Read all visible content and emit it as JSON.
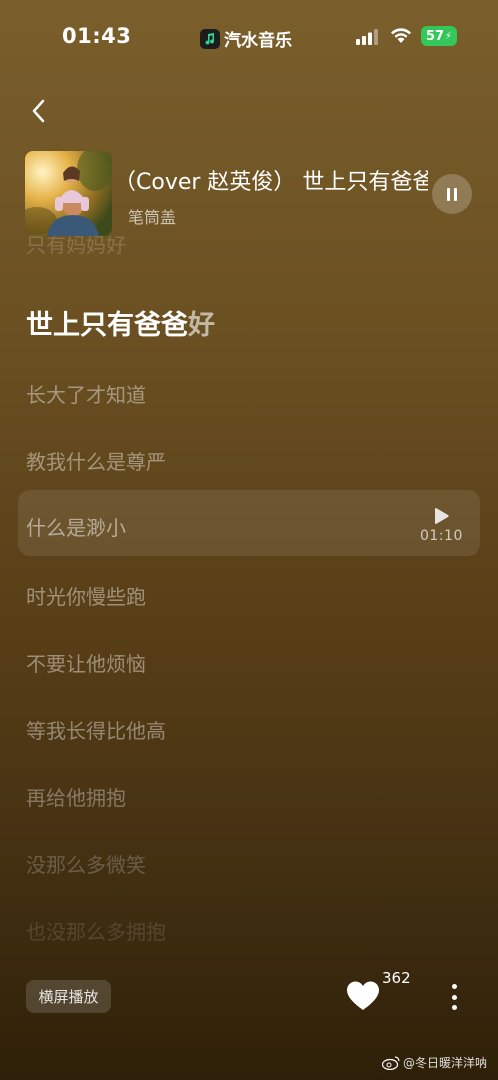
{
  "status_bar": {
    "time": "01:43",
    "app_name": "汽水音乐",
    "battery": "57"
  },
  "now_playing": {
    "title": "（Cover 赵英俊） 世上只有爸爸好",
    "artist": "笔筒盖"
  },
  "lyrics": {
    "previous": "只有妈妈好",
    "current_sung": "世上只有爸爸",
    "current_unsung": "好",
    "lines": [
      "长大了才知道",
      "教我什么是尊严",
      "什么是渺小",
      "时光你慢些跑",
      "不要让他烦恼",
      "等我长得比他高",
      "再给他拥抱",
      "没那么多微笑",
      "也没那么多拥抱"
    ],
    "seek_time": "01:10"
  },
  "bottom_bar": {
    "landscape_label": "横屏播放",
    "like_count": "362"
  },
  "watermark": "@冬日暖洋洋呐",
  "colors": {
    "background_top": "#7a5f2c",
    "background_bottom": "#2e2008",
    "battery_green": "#34c759"
  },
  "icons": [
    "music-app-logo-icon",
    "signal-icon",
    "wifi-icon",
    "battery-icon",
    "back-arrow-icon",
    "pause-icon",
    "play-icon",
    "heart-icon",
    "more-dots-icon",
    "weibo-icon"
  ]
}
